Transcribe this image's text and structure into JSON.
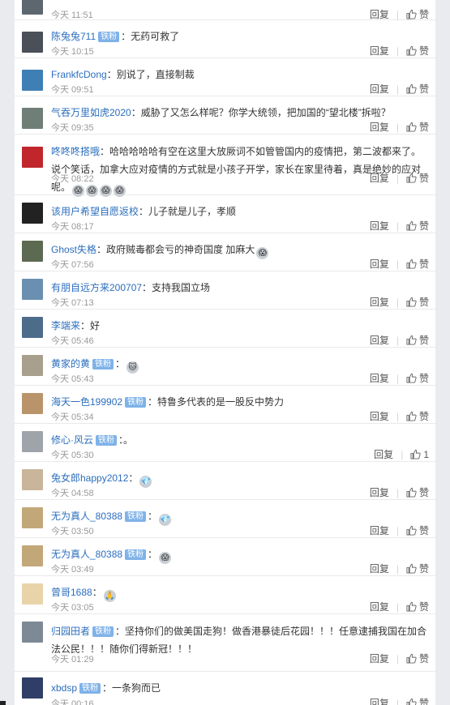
{
  "labels": {
    "reply": "回复",
    "sep": "|",
    "like": "赞"
  },
  "comments": [
    {
      "user": "",
      "badge": "",
      "text": "",
      "time": "今天 11:51",
      "likes": "赞",
      "avatar_color": "#5c6770"
    },
    {
      "user": "陈兔兔711",
      "badge": "铁粉",
      "text": "：无药可救了",
      "time": "今天 10:15",
      "likes": "赞",
      "avatar_color": "#4a4f58"
    },
    {
      "user": "FrankfcDong",
      "badge": "",
      "text": "：别说了，直接制裁",
      "time": "今天 09:51",
      "likes": "赞",
      "avatar_color": "#3e7fb5"
    },
    {
      "user": "气吞万里如虎2020",
      "badge": "",
      "text": "：威胁了又怎么样呢？你学大统领，把加国的“望北楼”拆啦？",
      "time": "今天 09:35",
      "likes": "赞",
      "avatar_color": "#6f7f77"
    },
    {
      "user": "咚咚咚搭哦",
      "badge": "",
      "text": "：哈哈哈哈哈有空在这里大放厥词不如管管国内的疫情把，第二波都来了。说个笑话，加拿大应对疫情的方式就是小孩子开学，家长在家里待着，真是绝妙的应对呢。",
      "emos": [
        "😱",
        "😱",
        "😱",
        "😱"
      ],
      "time": "今天 08:22",
      "likes": "赞",
      "avatar_color": "#c0262c"
    },
    {
      "user": "该用户希望自愿返校",
      "badge": "",
      "text": "：儿子就是儿子，孝顺",
      "time": "今天 08:17",
      "likes": "赞",
      "avatar_color": "#222222"
    },
    {
      "user": "Ghost失格",
      "badge": "",
      "text": "：政府贼毒都会亏的神奇国度  加麻大",
      "emos": [
        "😱"
      ],
      "time": "今天 07:56",
      "likes": "赞",
      "avatar_color": "#5d6a52"
    },
    {
      "user": "有朋自远方来200707",
      "badge": "",
      "text": "：支持我国立场",
      "time": "今天 07:13",
      "likes": "赞",
      "avatar_color": "#6a8fb0"
    },
    {
      "user": "李端来",
      "badge": "",
      "text": "：好",
      "time": "今天 05:46",
      "likes": "赞",
      "avatar_color": "#4d6c8a"
    },
    {
      "user": "黄家的黄",
      "badge": "铁粉",
      "text": "：",
      "emos": [
        "🐱"
      ],
      "time": "今天 05:43",
      "likes": "赞",
      "avatar_color": "#a89f8c"
    },
    {
      "user": "海天一色199902",
      "badge": "铁粉",
      "text": "：特鲁多代表的是一股反中势力",
      "time": "今天 05:34",
      "likes": "赞",
      "avatar_color": "#b9946a"
    },
    {
      "user": "修心·风云",
      "badge": "铁粉",
      "text": "：。",
      "time": "今天 05:30",
      "likes": "1",
      "avatar_color": "#9fa4aa"
    },
    {
      "user": "兔女郎happy2012",
      "badge": "",
      "text": "：",
      "emos": [
        "💎"
      ],
      "time": "今天 04:58",
      "likes": "赞",
      "avatar_color": "#c8b59a"
    },
    {
      "user": "无为真人_80388",
      "badge": "铁粉",
      "text": "：",
      "emos": [
        "💎"
      ],
      "time": "今天 03:50",
      "likes": "赞",
      "avatar_color": "#c2a779"
    },
    {
      "user": "无为真人_80388",
      "badge": "铁粉",
      "text": "：",
      "emos": [
        "😱"
      ],
      "time": "今天 03:49",
      "likes": "赞",
      "avatar_color": "#c2a779"
    },
    {
      "user": "曾哥1688",
      "badge": "",
      "text": "：",
      "emos": [
        "🙏"
      ],
      "time": "今天 03:05",
      "likes": "赞",
      "avatar_color": "#e8d4a8"
    },
    {
      "user": "归园田者",
      "badge": "铁粉",
      "text": "：坚持你们的做美国走狗！做香港暴徒后花园！！！任意逮捕我国在加合法公民！！！随你们得新冠！！！",
      "time": "今天 01:29",
      "likes": "赞",
      "avatar_color": "#7d8a96"
    },
    {
      "user": "xbdsp",
      "badge": "铁粉",
      "text": "：一条狗而已",
      "time": "今天 00:16",
      "likes": "赞",
      "avatar_color": "#2f3e66"
    }
  ]
}
